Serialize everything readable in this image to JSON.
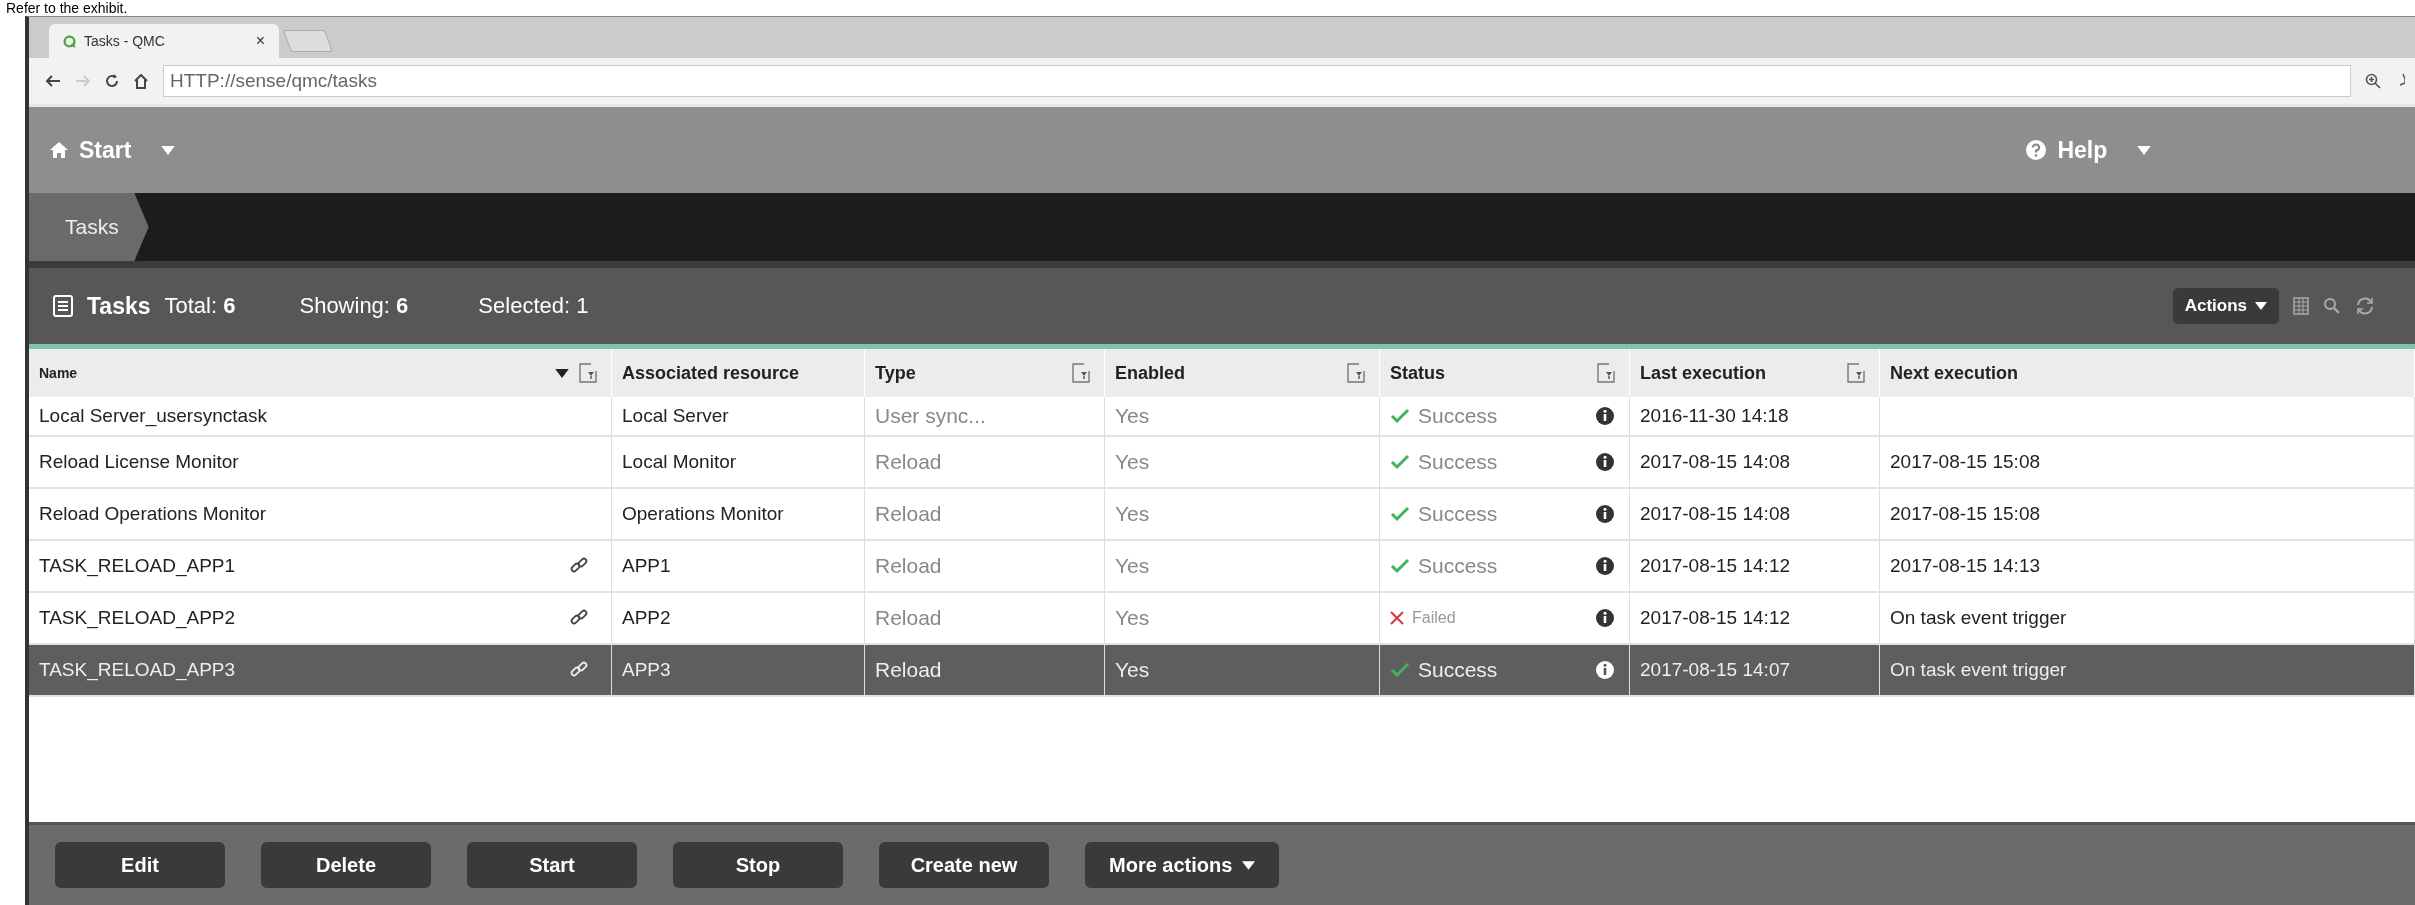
{
  "caption": "Refer to the exhibit.",
  "browser": {
    "tab_title": "Tasks - QMC",
    "tab_close": "×",
    "address": "HTTP://sense/qmc/tasks"
  },
  "nav": {
    "start": "Start",
    "help": "Help"
  },
  "breadcrumb": [
    "Tasks"
  ],
  "panel": {
    "title": "Tasks",
    "total_label": "Total:",
    "total": "6",
    "showing_label": "Showing:",
    "showing": "6",
    "selected_label": "Selected: 1",
    "actions": "Actions"
  },
  "table": {
    "columns": [
      {
        "label": "Name",
        "sorted": true,
        "filter": true
      },
      {
        "label": "Associated resource",
        "sorted": false,
        "filter": false
      },
      {
        "label": "Type",
        "sorted": false,
        "filter": true
      },
      {
        "label": "Enabled",
        "sorted": false,
        "filter": true
      },
      {
        "label": "Status",
        "sorted": false,
        "filter": true
      },
      {
        "label": "Last execution",
        "sorted": false,
        "filter": true
      },
      {
        "label": "Next execution",
        "sorted": false,
        "filter": false
      }
    ],
    "rows": [
      {
        "name": "Local Server_usersynctask",
        "linked": false,
        "resource": "Local Server",
        "type": "User sync...",
        "enabled": "Yes",
        "status": "Success",
        "succeeded": true,
        "last": "2016-11-30 14:18",
        "selected": false
      },
      {
        "name": "Reload License Monitor",
        "linked": false,
        "resource": "Local Monitor",
        "type": "Reload",
        "enabled": "Yes",
        "status": "Success",
        "succeeded": true,
        "last": "2017-08-15 14:08",
        "next": "2017-08-15 15:08",
        "selected": false
      },
      {
        "name": "Reload Operations Monitor",
        "linked": false,
        "resource": "Operations Monitor",
        "type": "Reload",
        "enabled": "Yes",
        "status": "Success",
        "succeeded": true,
        "last": "2017-08-15 14:08",
        "next": "2017-08-15 15:08",
        "selected": false
      },
      {
        "name": "TASK_RELOAD_APP1",
        "linked": true,
        "resource": "APP1",
        "type": "Reload",
        "enabled": "Yes",
        "status": "Success",
        "succeeded": true,
        "last": "2017-08-15 14:12",
        "next": "2017-08-15 14:13",
        "selected": false
      },
      {
        "name": "TASK_RELOAD_APP2",
        "linked": true,
        "resource": "APP2",
        "type": "Reload",
        "enabled": "Yes",
        "status": "Failed",
        "succeeded": false,
        "last": "2017-08-15 14:12",
        "next": "On task event trigger",
        "selected": false
      },
      {
        "name": "TASK_RELOAD_APP3",
        "linked": true,
        "resource": "APP3",
        "type": "Reload",
        "enabled": "Yes",
        "status": "Success",
        "succeeded": true,
        "last": "2017-08-15 14:07",
        "next": "On task event trigger",
        "selected": true
      }
    ]
  },
  "buttons": [
    {
      "label": "Edit",
      "menu": false
    },
    {
      "label": "Delete",
      "menu": false
    },
    {
      "label": "Start",
      "menu": false
    },
    {
      "label": "Stop",
      "menu": false
    },
    {
      "label": "Create new",
      "menu": false
    },
    {
      "label": "More actions",
      "menu": true
    }
  ]
}
